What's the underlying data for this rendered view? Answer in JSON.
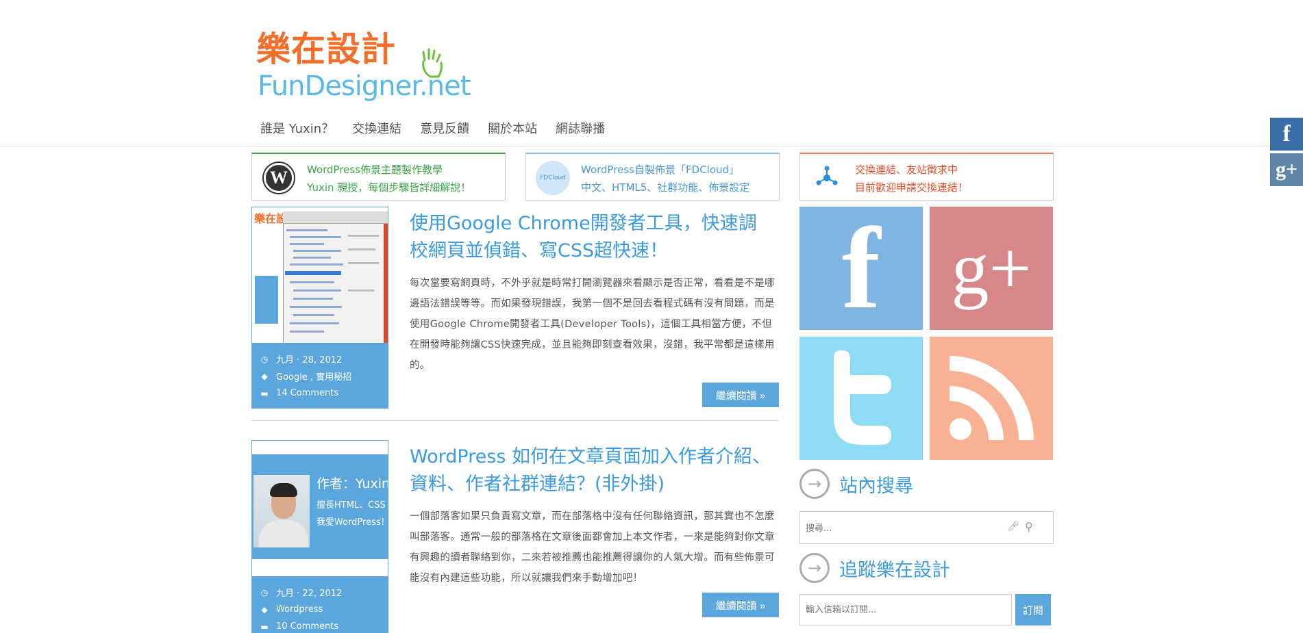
{
  "site": {
    "logo_cn": "樂在設計",
    "logo_en": "FunDesigner.net"
  },
  "nav": {
    "items": [
      "誰是 Yuxin？",
      "交換連結",
      "意見反饋",
      "關於本站",
      "網誌聯播"
    ]
  },
  "side_social": {
    "facebook_glyph": "f",
    "googleplus_glyph": "g+"
  },
  "banners": [
    {
      "line1": "WordPress佈景主題製作教學",
      "line2": "Yuxin 親授，每個步驟皆詳細解說！",
      "icon": "wordpress-logo-icon",
      "color": "#3aa64a"
    },
    {
      "line1": "WordPress自製佈景「FDCloud」",
      "line2": "中文、HTML5、社群功能、佈景設定",
      "icon": "fdcloud-icon",
      "icon_text": "FDCloud",
      "color": "#4b9ad6"
    },
    {
      "line1": "交換連結、友站徵求中",
      "line2": "目前歡迎申請交換連結！",
      "icon": "network-icon",
      "color": "#ef4d2a"
    }
  ],
  "posts": [
    {
      "title": "使用Google Chrome開發者工具，快速調校網頁並偵錯、寫CSS超快速！",
      "excerpt": "每次當要寫網頁時，不外乎就是時常打開瀏覽器來看顯示是否正常，看看是不是哪邊語法錯誤等等。而如果發現錯誤，我第一個不是回去看程式碼有沒有問題，而是使用Google Chrome開發者工具(Developer Tools)，這個工具相當方便，不但在開發時能夠讓CSS快速完成，並且能夠即刻查看效果，沒錯，我平常都是這樣用的。",
      "date": "九月 · 28, 2012",
      "tags": "Google , 實用秘招",
      "comments": "14 Comments",
      "thumb_logo": "樂在設計",
      "read_more": "繼續閱讀 »"
    },
    {
      "title": "WordPress 如何在文章頁面加入作者介紹、資料、作者社群連結？(非外掛)",
      "excerpt": "一個部落客如果只負責寫文章，而在部落格中沒有任何聯絡資訊，那其實也不怎麼叫部落客。通常一般的部落格在文章後面都會加上本文作者，一來是能夠對你文章有興趣的讀者聯絡到你，二來若被推薦也能推薦得讓你的人氣大增。而有些佈景可能沒有內建這些功能，所以就讓我們來手動增加吧！",
      "date": "九月 · 22, 2012",
      "tags": "Wordpress",
      "comments": "10 Comments",
      "thumb_name": "作者：Yuxin",
      "thumb_line1": "擅長HTML、CSS",
      "thumb_line2": "我愛WordPress！",
      "read_more": "繼續閱讀 »"
    }
  ],
  "sidebar": {
    "tiles": [
      {
        "name": "facebook",
        "glyph": "f",
        "color": "#7fb5e0"
      },
      {
        "name": "googleplus",
        "glyph": "g+",
        "color": "#d7868a"
      },
      {
        "name": "twitter",
        "color": "#8edcf3"
      },
      {
        "name": "rss",
        "color": "#f9b093"
      }
    ],
    "search_title": "站內搜尋",
    "search_placeholder": "搜尋...",
    "follow_title": "追蹤樂在設計",
    "subscribe_placeholder": "輸入信箱以訂閱...",
    "subscribe_button": "訂閱"
  }
}
